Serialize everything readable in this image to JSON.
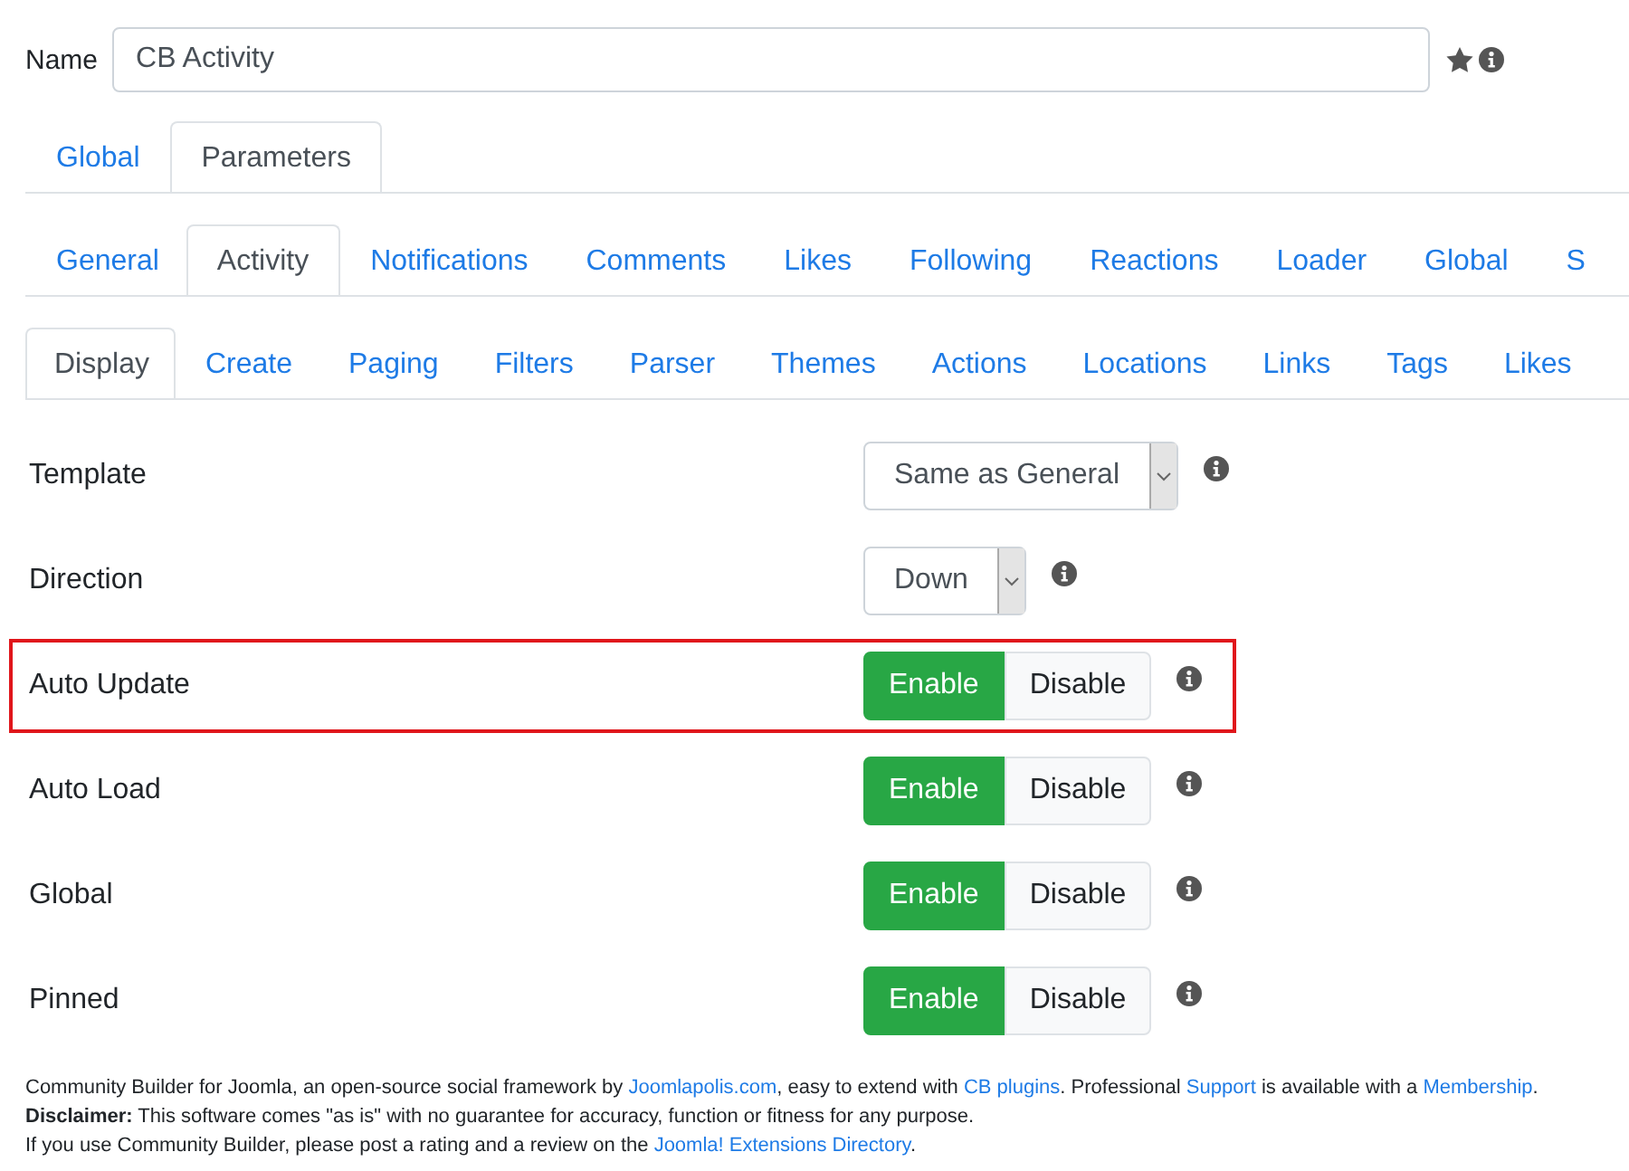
{
  "name_field": {
    "label": "Name",
    "value": "CB Activity"
  },
  "top_tabs": [
    {
      "label": "Global",
      "selected": false
    },
    {
      "label": "Parameters",
      "selected": true
    }
  ],
  "plugin_tabs": [
    {
      "label": "General",
      "selected": false
    },
    {
      "label": "Activity",
      "selected": true
    },
    {
      "label": "Notifications",
      "selected": false
    },
    {
      "label": "Comments",
      "selected": false
    },
    {
      "label": "Likes",
      "selected": false
    },
    {
      "label": "Following",
      "selected": false
    },
    {
      "label": "Reactions",
      "selected": false
    },
    {
      "label": "Loader",
      "selected": false
    },
    {
      "label": "Global",
      "selected": false
    },
    {
      "label": "S",
      "selected": false
    }
  ],
  "sub_tabs": [
    {
      "label": "Display",
      "selected": true
    },
    {
      "label": "Create",
      "selected": false
    },
    {
      "label": "Paging",
      "selected": false
    },
    {
      "label": "Filters",
      "selected": false
    },
    {
      "label": "Parser",
      "selected": false
    },
    {
      "label": "Themes",
      "selected": false
    },
    {
      "label": "Actions",
      "selected": false
    },
    {
      "label": "Locations",
      "selected": false
    },
    {
      "label": "Links",
      "selected": false
    },
    {
      "label": "Tags",
      "selected": false
    },
    {
      "label": "Likes",
      "selected": false
    }
  ],
  "settings": [
    {
      "label": "Template",
      "kind": "select",
      "value": "Same as General",
      "highlighted": false
    },
    {
      "label": "Direction",
      "kind": "select",
      "value": "Down",
      "highlighted": false
    },
    {
      "label": "Auto Update",
      "kind": "toggle",
      "highlighted": true,
      "options": [
        {
          "label": "Enable",
          "selected": true
        },
        {
          "label": "Disable",
          "selected": false
        }
      ]
    },
    {
      "label": "Auto Load",
      "kind": "toggle",
      "highlighted": false,
      "options": [
        {
          "label": "Enable",
          "selected": true
        },
        {
          "label": "Disable",
          "selected": false
        }
      ]
    },
    {
      "label": "Global",
      "kind": "toggle",
      "highlighted": false,
      "options": [
        {
          "label": "Enable",
          "selected": true
        },
        {
          "label": "Disable",
          "selected": false
        }
      ]
    },
    {
      "label": "Pinned",
      "kind": "toggle",
      "highlighted": false,
      "options": [
        {
          "label": "Enable",
          "selected": true
        },
        {
          "label": "Disable",
          "selected": false
        }
      ]
    }
  ],
  "footer": [
    [
      {
        "kind": "text",
        "text": "Community Builder for Joomla, an open-source social framework by "
      },
      {
        "kind": "link",
        "text": "Joomlapolis.com"
      },
      {
        "kind": "text",
        "text": ", easy to extend with "
      },
      {
        "kind": "link",
        "text": "CB plugins"
      },
      {
        "kind": "text",
        "text": ". Professional "
      },
      {
        "kind": "link",
        "text": "Support"
      },
      {
        "kind": "text",
        "text": " is available with a "
      },
      {
        "kind": "link",
        "text": "Membership"
      },
      {
        "kind": "text",
        "text": "."
      }
    ],
    [
      {
        "kind": "bold",
        "text": "Disclaimer:"
      },
      {
        "kind": "text",
        "text": " This software comes \"as is\" with no guarantee for accuracy, function or fitness for any purpose."
      }
    ],
    [
      {
        "kind": "text",
        "text": "If you use Community Builder, please post a rating and a review on the "
      },
      {
        "kind": "link",
        "text": "Joomla! Extensions Directory"
      },
      {
        "kind": "text",
        "text": "."
      }
    ]
  ]
}
